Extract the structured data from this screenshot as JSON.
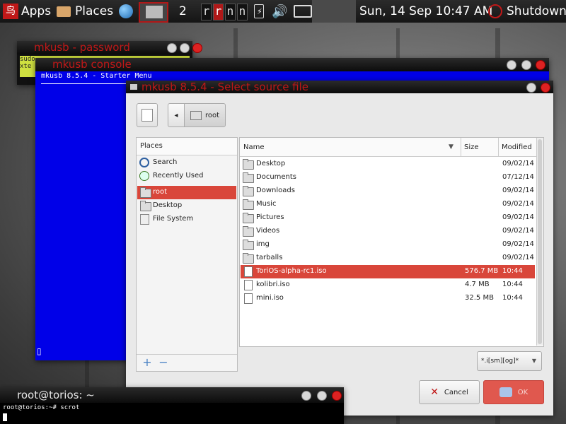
{
  "panel": {
    "apps_label": "Apps",
    "places_label": "Places",
    "workspace_number": "2",
    "workspace_letters": [
      "r",
      "r",
      "n",
      "n"
    ],
    "clock": "Sun, 14 Sep 10:47 AM",
    "shutdown_label": "Shutdown"
  },
  "password_window": {
    "title": "mkusb - password",
    "lines": [
      "sudo",
      "xte"
    ]
  },
  "console_window": {
    "title": "mkusb console",
    "header_line": "mkusb 8.5.4 - Starter Menu",
    "cursor": "▯"
  },
  "dialog": {
    "title": "mkusb 8.5.4 - Select source file",
    "path_button": "root",
    "places_header": "Places",
    "places": [
      {
        "label": "Search",
        "icon": "search-icon"
      },
      {
        "label": "Recently Used",
        "icon": "clock-icon"
      },
      {
        "label": "root",
        "icon": "folder-icon",
        "selected": true
      },
      {
        "label": "Desktop",
        "icon": "folder-icon"
      },
      {
        "label": "File System",
        "icon": "drive-icon"
      }
    ],
    "columns": {
      "name": "Name",
      "size": "Size",
      "modified": "Modified"
    },
    "files": [
      {
        "name": "Desktop",
        "size": "",
        "modified": "09/02/14",
        "type": "folder"
      },
      {
        "name": "Documents",
        "size": "",
        "modified": "07/12/14",
        "type": "folder"
      },
      {
        "name": "Downloads",
        "size": "",
        "modified": "09/02/14",
        "type": "folder"
      },
      {
        "name": "Music",
        "size": "",
        "modified": "09/02/14",
        "type": "folder"
      },
      {
        "name": "Pictures",
        "size": "",
        "modified": "09/02/14",
        "type": "folder"
      },
      {
        "name": "Videos",
        "size": "",
        "modified": "09/02/14",
        "type": "folder"
      },
      {
        "name": "img",
        "size": "",
        "modified": "09/02/14",
        "type": "folder"
      },
      {
        "name": "tarballs",
        "size": "",
        "modified": "09/02/14",
        "type": "folder"
      },
      {
        "name": "ToriOS-alpha-rc1.iso",
        "size": "576.7 MB",
        "modified": "10:44",
        "type": "file",
        "selected": true
      },
      {
        "name": "kolibri.iso",
        "size": "4.7 MB",
        "modified": "10:44",
        "type": "file"
      },
      {
        "name": "mini.iso",
        "size": "32.5 MB",
        "modified": "10:44",
        "type": "file"
      }
    ],
    "filter": "*.i[sm][og]*",
    "cancel_label": "Cancel",
    "ok_label": "OK",
    "colors": {
      "selection": "#d9463a",
      "ok_button": "#e0584e"
    }
  },
  "terminal": {
    "title": "root@torios: ~",
    "prompt_line": "root@torios:~# scrot"
  }
}
